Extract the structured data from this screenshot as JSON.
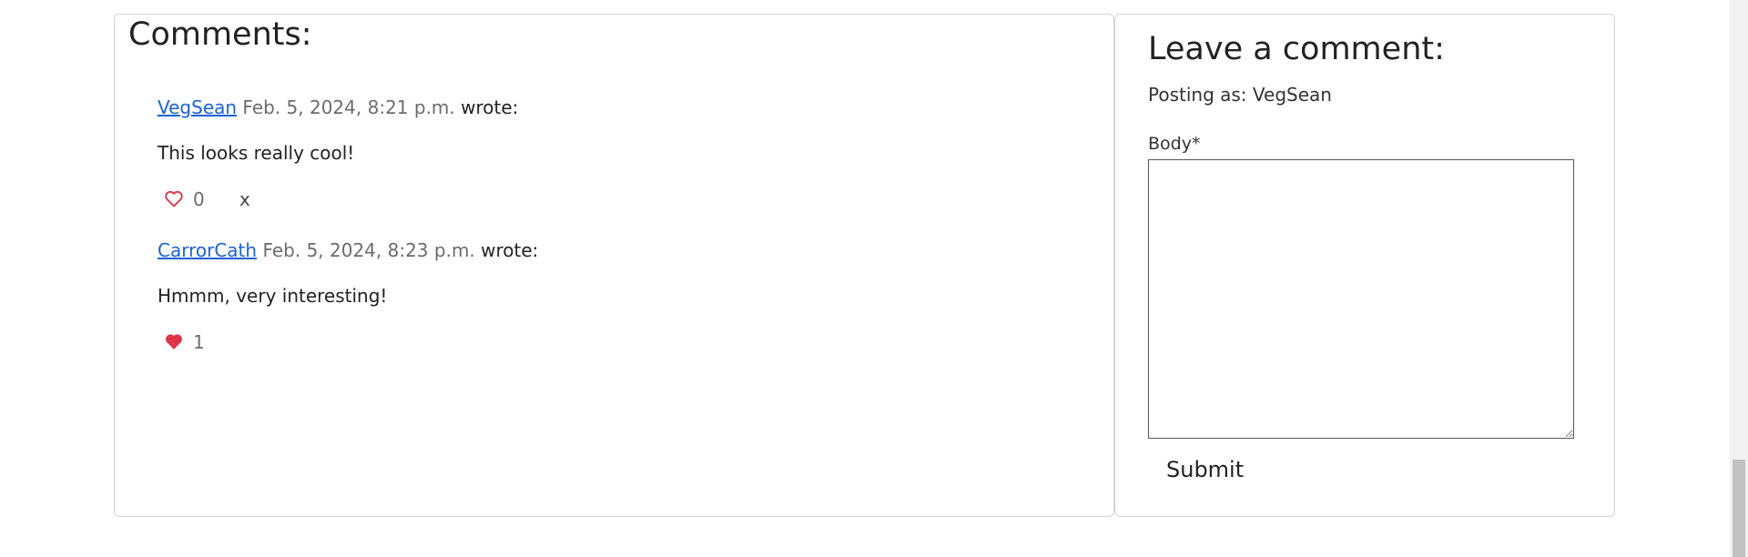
{
  "comments_section": {
    "title": "Comments:",
    "comments": [
      {
        "author": "VegSean",
        "date": "Feb. 5, 2024, 8:21 p.m.",
        "wrote": "wrote:",
        "body": "This looks really cool!",
        "likes": "0",
        "liked": false,
        "delete_label": "x"
      },
      {
        "author": "CarrorCath",
        "date": "Feb. 5, 2024, 8:23 p.m.",
        "wrote": "wrote:",
        "body": "Hmmm, very interesting!",
        "likes": "1",
        "liked": true
      }
    ]
  },
  "comment_form": {
    "title": "Leave a comment:",
    "posting_as": "Posting as: VegSean",
    "body_label": "Body*",
    "body_value": "",
    "submit_label": "Submit"
  },
  "colors": {
    "link": "#1c62d6",
    "heart_outline": "#dc3545",
    "heart_filled": "#dc3545",
    "border": "#d4d4d4"
  },
  "icons": {
    "like_outline": "heart-outline-icon",
    "like_filled": "heart-filled-icon"
  }
}
